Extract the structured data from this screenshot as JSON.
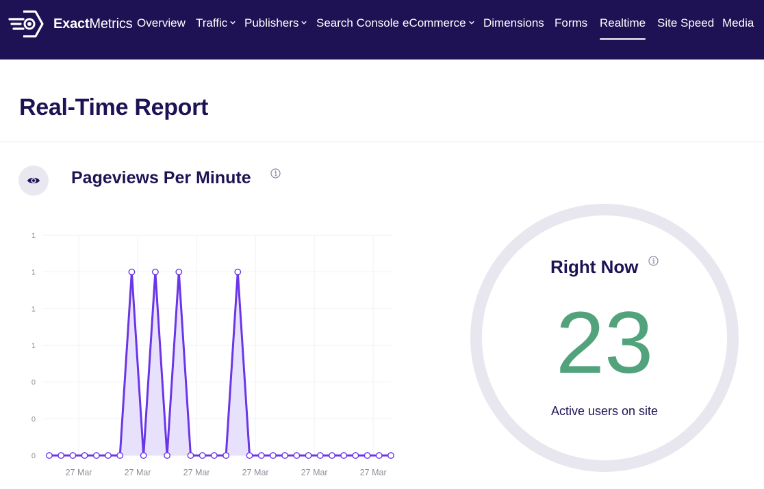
{
  "header": {
    "brand_bold": "Exact",
    "brand_light": "Metrics",
    "nav": [
      {
        "label": "Overview",
        "dropdown": false,
        "active": false
      },
      {
        "label": "Traffic",
        "dropdown": true,
        "active": false
      },
      {
        "label": "Publishers",
        "dropdown": true,
        "active": false
      },
      {
        "label": "Search Console",
        "dropdown": false,
        "active": false
      },
      {
        "label": "eCommerce",
        "dropdown": true,
        "active": false
      },
      {
        "label": "Dimensions",
        "dropdown": false,
        "active": false
      },
      {
        "label": "Forms",
        "dropdown": false,
        "active": false
      },
      {
        "label": "Realtime",
        "dropdown": false,
        "active": true
      },
      {
        "label": "Site Speed",
        "dropdown": false,
        "active": false
      },
      {
        "label": "Media",
        "dropdown": false,
        "active": false
      }
    ]
  },
  "page": {
    "title": "Real-Time Report"
  },
  "pageviews": {
    "title": "Pageviews Per Minute",
    "icon": "eye-icon",
    "info_icon": "info-icon"
  },
  "right_now": {
    "title": "Right Now",
    "value": "23",
    "label": "Active users on site",
    "value_color": "#52a37c"
  },
  "colors": {
    "nav_bg": "#1f1254",
    "heading": "#1f1254",
    "line": "#6b35e8",
    "fill": "#e4dcfa"
  },
  "chart_data": {
    "type": "line",
    "title": "Pageviews Per Minute",
    "xlabel": "",
    "ylabel": "",
    "ylim": [
      0,
      1.2
    ],
    "y_ticks": [
      0,
      0.2,
      0.4,
      0.6,
      0.8,
      1.0,
      1.2
    ],
    "y_tick_labels": [
      "0",
      "0",
      "0",
      "1",
      "1",
      "1",
      "1"
    ],
    "x_tick_labels": [
      "27 Mar",
      "27 Mar",
      "27 Mar",
      "27 Mar",
      "27 Mar",
      "27 Mar"
    ],
    "x_tick_indices": [
      2.5,
      7.5,
      12.5,
      17.5,
      22.5,
      27.5
    ],
    "grid": true,
    "legend": "none",
    "series": [
      {
        "name": "Pageviews",
        "values": [
          0,
          0,
          0,
          0,
          0,
          0,
          0,
          1,
          0,
          1,
          0,
          1,
          0,
          0,
          0,
          0,
          1,
          0,
          0,
          0,
          0,
          0,
          0,
          0,
          0,
          0,
          0,
          0,
          0,
          0
        ]
      }
    ]
  }
}
